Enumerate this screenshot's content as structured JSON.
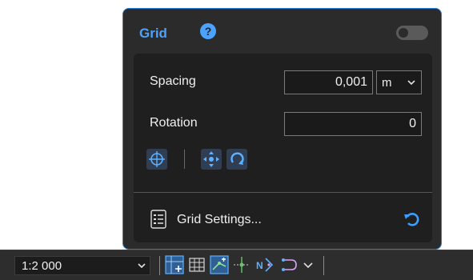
{
  "panel": {
    "title": "Grid",
    "help_icon": "help-circle-icon",
    "enabled": false,
    "spacing": {
      "label": "Spacing",
      "value": "0,001",
      "unit": "m"
    },
    "rotation": {
      "label": "Rotation",
      "value": "0"
    },
    "tools": [
      "crosshair-target-icon",
      "move-arrows-icon",
      "rotate-icon"
    ],
    "settings_label": "Grid Settings...",
    "reset_icon": "undo-icon"
  },
  "statusbar": {
    "scale": "1:2 000",
    "icons": [
      "grid-add-icon",
      "grid-table-icon",
      "snap-grid-icon",
      "crosshair-move-icon",
      "north-arrow-icon",
      "connector-icon",
      "chevron-down-icon"
    ]
  },
  "colors": {
    "accent": "#1e7fd6",
    "title": "#4aa3ff",
    "icon_blue": "#3aa0ff"
  }
}
